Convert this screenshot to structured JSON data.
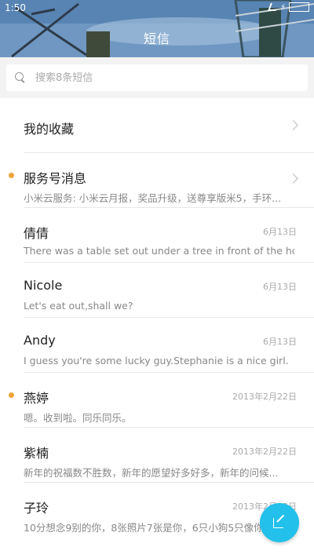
{
  "status_bar": {
    "time": "1:50"
  },
  "header": {
    "title": "短信"
  },
  "search": {
    "placeholder": "搜索8条短信"
  },
  "favorites": {
    "label": "我的收藏"
  },
  "conversations": [
    {
      "name": "服务号消息",
      "preview": "小米云服务: 小米云月报，奖品升级，送尊享版米5，手环...",
      "date": "",
      "unread": true,
      "chevron": true
    },
    {
      "name": "倩倩",
      "preview": "There was a table set out under a tree in front of the ho...",
      "date": "6月13日",
      "unread": false
    },
    {
      "name": "Nicole",
      "preview": "Let's eat out,shall we?",
      "date": "6月13日",
      "unread": false
    },
    {
      "name": "Andy",
      "preview": "I guess you're some lucky guy.Stephanie is a nice girl.",
      "date": "6月13日",
      "unread": false
    },
    {
      "name": "燕婷",
      "preview": "嗯。收到啦。同乐同乐。",
      "date": "2013年2月22日",
      "unread": true
    },
    {
      "name": "紫楠",
      "preview": "新年的祝福数不胜数，新年的愿望好多好多，新年的问候...",
      "date": "2013年2月22日",
      "unread": false
    },
    {
      "name": "子玲",
      "preview": "10分想念9别的你，8张照片7张是你，6只小狗5只像你",
      "date": "2013年2月22日",
      "unread": false
    }
  ],
  "colors": {
    "accent": "#23c0eb",
    "unread_dot": "#f0a33a"
  },
  "icons": {
    "fab": "compose-icon",
    "search": "search-icon"
  }
}
